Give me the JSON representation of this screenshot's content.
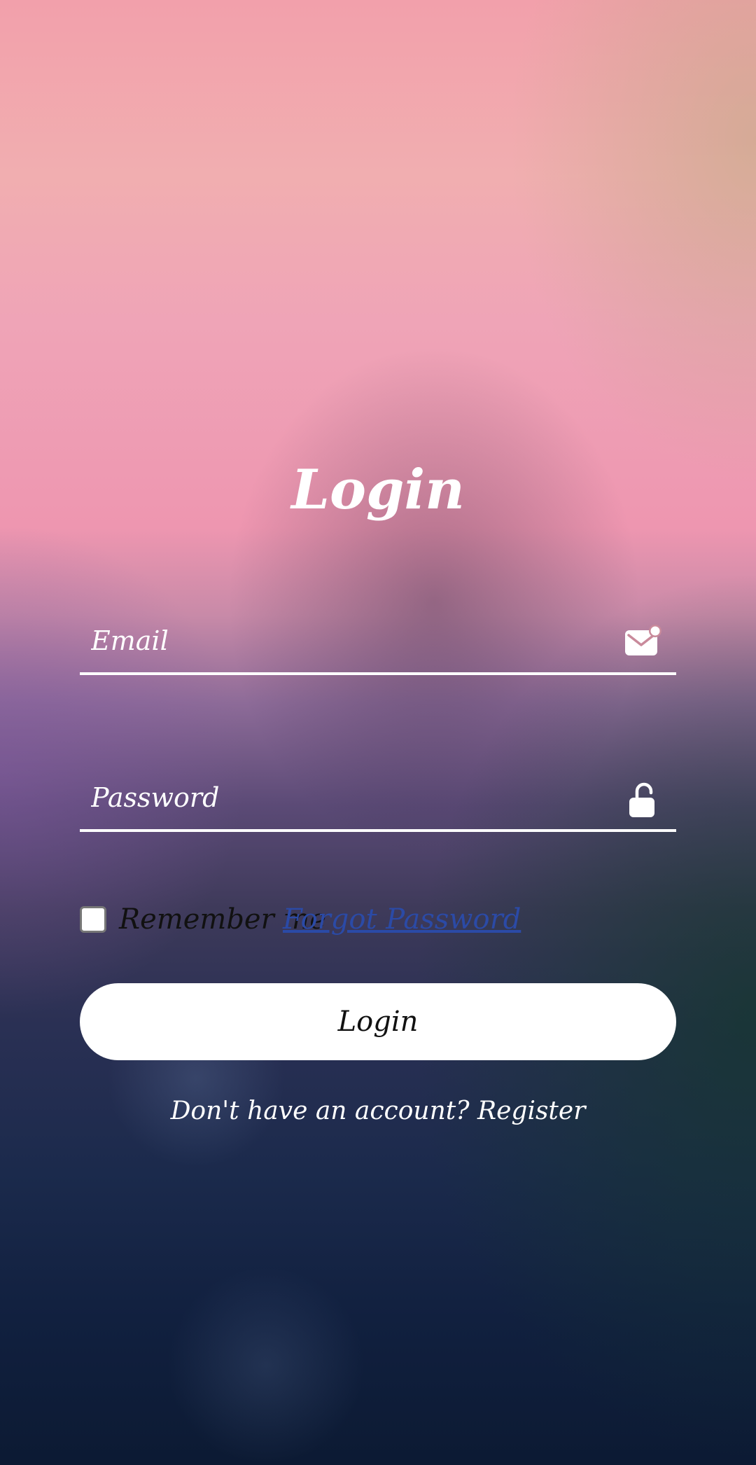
{
  "form": {
    "title": "Login",
    "email": {
      "placeholder": "Email",
      "value": "",
      "icon": "mail-notification-icon"
    },
    "password": {
      "placeholder": "Password",
      "value": "",
      "icon": "unlock-icon"
    },
    "remember_label": "Remember me",
    "forgot_label": "Forgot Password",
    "login_button_label": "Login",
    "register_prompt": "Don't have an account?",
    "register_link": "Register"
  },
  "colors": {
    "text": "#ffffff",
    "button_bg": "#ffffff",
    "button_text": "#111111",
    "link": "#2b4aa6"
  }
}
